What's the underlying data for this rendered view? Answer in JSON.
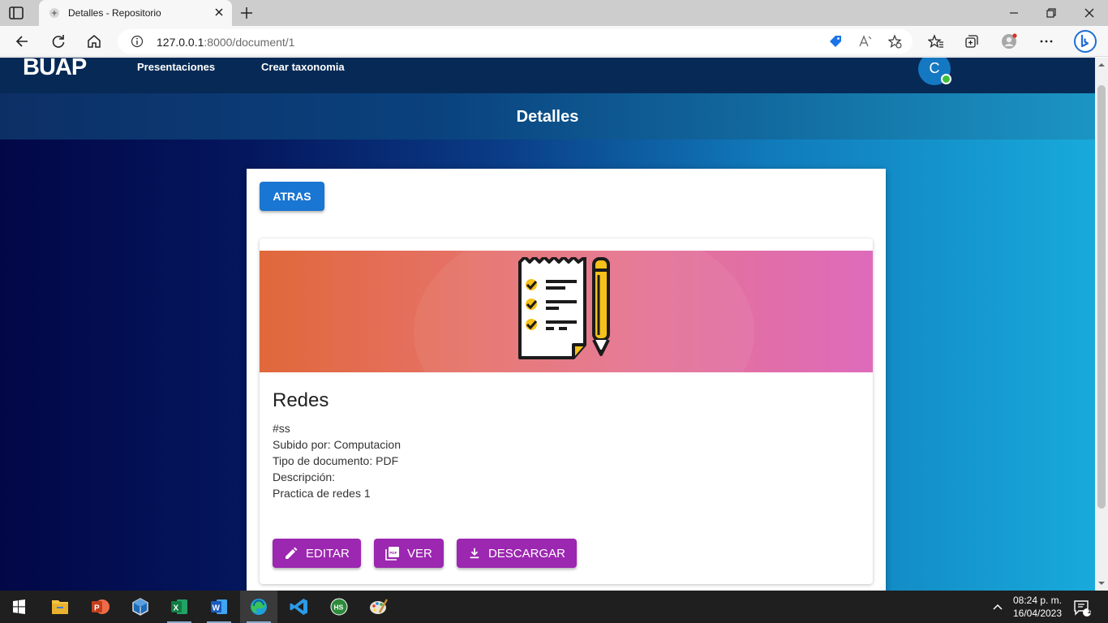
{
  "browser": {
    "tab_title": "Detalles - Repositorio",
    "url_host": "127.0.0.1",
    "url_rest": ":8000/document/1"
  },
  "site": {
    "logo": "BUAP",
    "nav": [
      "Presentaciones",
      "Crear taxonomia"
    ],
    "avatar_letter": "C"
  },
  "page": {
    "title": "Detalles",
    "back_label": "ATRAS"
  },
  "document": {
    "title": "Redes",
    "tag": "#ss",
    "uploaded_by": "Subido por: Computacion",
    "doc_type": "Tipo de documento: PDF",
    "description_label": "Descripción:",
    "description": "Practica de redes 1",
    "actions": {
      "edit": "EDITAR",
      "view": "VER",
      "download": "DESCARGAR"
    }
  },
  "taskbar": {
    "time": "08:24 p. m.",
    "date": "16/04/2023",
    "notifications": "1"
  },
  "colors": {
    "primary": "#1976d2",
    "accent": "#9c27b0"
  }
}
